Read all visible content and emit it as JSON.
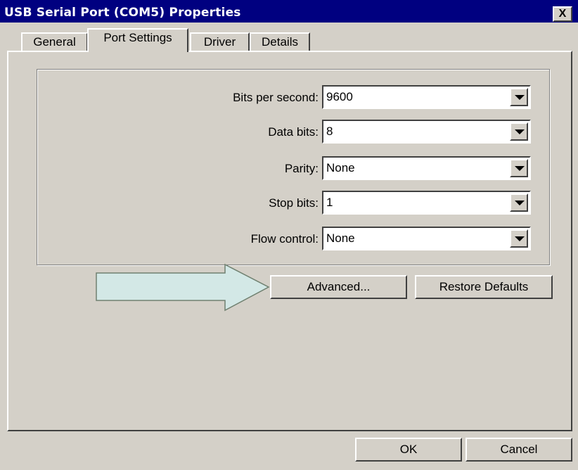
{
  "window": {
    "title": "USB Serial Port (COM5) Properties",
    "close_label": "X"
  },
  "tabs": [
    {
      "label": "General",
      "active": false
    },
    {
      "label": "Port Settings",
      "active": true
    },
    {
      "label": "Driver",
      "active": false
    },
    {
      "label": "Details",
      "active": false
    }
  ],
  "port_settings": {
    "fields": [
      {
        "label": "Bits per second:",
        "value": "9600"
      },
      {
        "label": "Data bits:",
        "value": "8"
      },
      {
        "label": "Parity:",
        "value": "None"
      },
      {
        "label": "Stop bits:",
        "value": "1"
      },
      {
        "label": "Flow control:",
        "value": "None"
      }
    ],
    "advanced_label": "Advanced...",
    "restore_label": "Restore Defaults"
  },
  "footer": {
    "ok_label": "OK",
    "cancel_label": "Cancel"
  },
  "annotation": {
    "arrow_color": "#d3e8e6",
    "points_to": "advanced-button"
  }
}
